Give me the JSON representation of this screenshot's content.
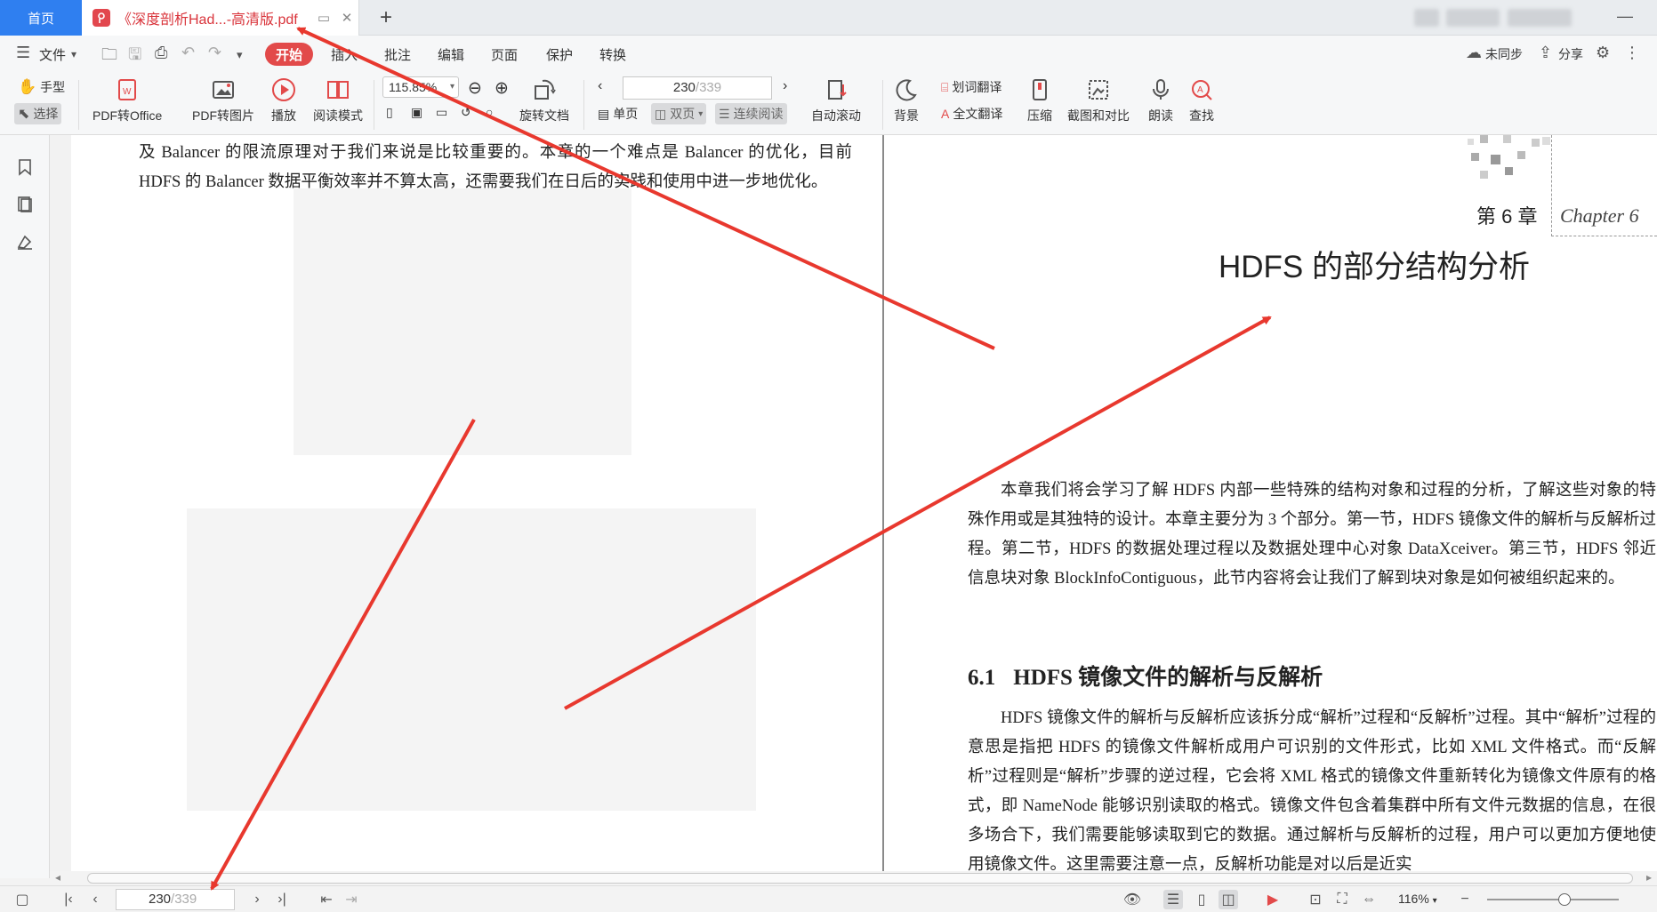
{
  "tabs": {
    "home_label": "首页",
    "doc_title": "《深度剖析Had...-高清版.pdf"
  },
  "menu": {
    "file_label": "文件",
    "items": [
      "开始",
      "插入",
      "批注",
      "编辑",
      "页面",
      "保护",
      "转换"
    ],
    "unsynced_label": "未同步",
    "share_label": "分享"
  },
  "ribbon": {
    "hand_label": "手型",
    "select_label": "选择",
    "pdf_to_office": "PDF转Office",
    "pdf_to_image": "PDF转图片",
    "play": "播放",
    "read_mode": "阅读模式",
    "zoom_value": "115.85%",
    "rotate_doc": "旋转文档",
    "page_current": "230",
    "page_total": "/339",
    "single_page": "单页",
    "double_page": "双页",
    "continuous_read": "连续阅读",
    "auto_scroll": "自动滚动",
    "background": "背景",
    "word_translate": "划词翻译",
    "full_translate": "全文翻译",
    "compress": "压缩",
    "screenshot_compare": "截图和对比",
    "read_aloud": "朗读",
    "find": "查找"
  },
  "document": {
    "left_paragraph": "及 Balancer 的限流原理对于我们来说是比较重要的。本章的一个难点是 Balancer 的优化，目前 HDFS 的 Balancer 数据平衡效率并不算太高，还需要我们在日后的实践和使用中进一步地优化。",
    "chapter_number": "第 6 章",
    "chapter_en": "Chapter 6",
    "chapter_title": "HDFS 的部分结构分析",
    "intro_paragraph": "本章我们将会学习了解 HDFS 内部一些特殊的结构对象和过程的分析，了解这些对象的特殊作用或是其独特的设计。本章主要分为 3 个部分。第一节，HDFS 镜像文件的解析与反解析过程。第二节，HDFS 的数据处理过程以及数据处理中心对象 DataXceiver。第三节，HDFS 邻近信息块对象 BlockInfoContiguous，此节内容将会让我们了解到块对象是如何被组织起来的。",
    "section_number": "6.1",
    "section_title": "HDFS 镜像文件的解析与反解析",
    "section_paragraph": "HDFS 镜像文件的解析与反解析应该拆分成“解析”过程和“反解析”过程。其中“解析”过程的意思是指把 HDFS 的镜像文件解析成用户可识别的文件形式，比如 XML 文件格式。而“反解析”过程则是“解析”步骤的逆过程，它会将 XML 格式的镜像文件重新转化为镜像文件原有的格式，即 NameNode 能够识别读取的格式。镜像文件包含着集群中所有文件元数据的信息，在很多场合下，我们需要能够读取到它的数据。通过解析与反解析的过程，用户可以更加方便地使用镜像文件。这里需要注意一点，反解析功能是对以后是近实"
  },
  "statusbar": {
    "page_current": "230",
    "page_total": "/339",
    "zoom_value": "116%"
  },
  "colors": {
    "accent_red": "#e24a4a",
    "tab_blue": "#2f7ff0",
    "annotation_red": "#e8382e"
  }
}
